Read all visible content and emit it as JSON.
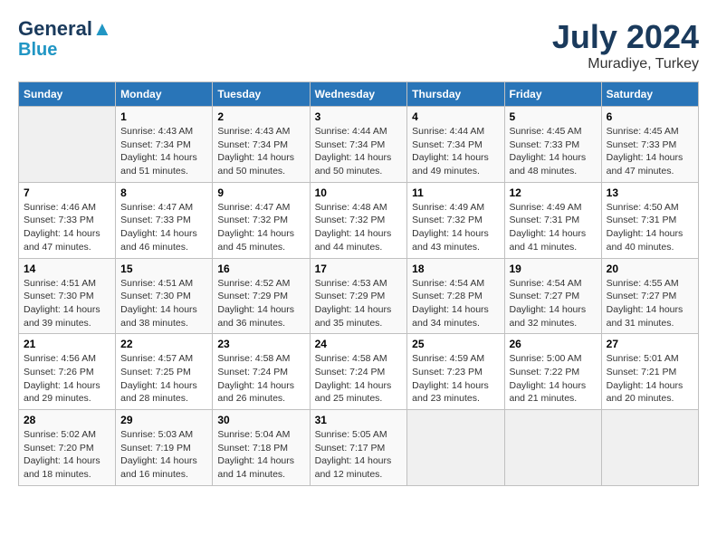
{
  "header": {
    "logo_line1": "General",
    "logo_line2": "Blue",
    "title": "July 2024",
    "subtitle": "Muradiye, Turkey"
  },
  "days_of_week": [
    "Sunday",
    "Monday",
    "Tuesday",
    "Wednesday",
    "Thursday",
    "Friday",
    "Saturday"
  ],
  "weeks": [
    [
      {
        "num": "",
        "sunrise": "",
        "sunset": "",
        "daylight": ""
      },
      {
        "num": "1",
        "sunrise": "Sunrise: 4:43 AM",
        "sunset": "Sunset: 7:34 PM",
        "daylight": "Daylight: 14 hours and 51 minutes."
      },
      {
        "num": "2",
        "sunrise": "Sunrise: 4:43 AM",
        "sunset": "Sunset: 7:34 PM",
        "daylight": "Daylight: 14 hours and 50 minutes."
      },
      {
        "num": "3",
        "sunrise": "Sunrise: 4:44 AM",
        "sunset": "Sunset: 7:34 PM",
        "daylight": "Daylight: 14 hours and 50 minutes."
      },
      {
        "num": "4",
        "sunrise": "Sunrise: 4:44 AM",
        "sunset": "Sunset: 7:34 PM",
        "daylight": "Daylight: 14 hours and 49 minutes."
      },
      {
        "num": "5",
        "sunrise": "Sunrise: 4:45 AM",
        "sunset": "Sunset: 7:33 PM",
        "daylight": "Daylight: 14 hours and 48 minutes."
      },
      {
        "num": "6",
        "sunrise": "Sunrise: 4:45 AM",
        "sunset": "Sunset: 7:33 PM",
        "daylight": "Daylight: 14 hours and 47 minutes."
      }
    ],
    [
      {
        "num": "7",
        "sunrise": "Sunrise: 4:46 AM",
        "sunset": "Sunset: 7:33 PM",
        "daylight": "Daylight: 14 hours and 47 minutes."
      },
      {
        "num": "8",
        "sunrise": "Sunrise: 4:47 AM",
        "sunset": "Sunset: 7:33 PM",
        "daylight": "Daylight: 14 hours and 46 minutes."
      },
      {
        "num": "9",
        "sunrise": "Sunrise: 4:47 AM",
        "sunset": "Sunset: 7:32 PM",
        "daylight": "Daylight: 14 hours and 45 minutes."
      },
      {
        "num": "10",
        "sunrise": "Sunrise: 4:48 AM",
        "sunset": "Sunset: 7:32 PM",
        "daylight": "Daylight: 14 hours and 44 minutes."
      },
      {
        "num": "11",
        "sunrise": "Sunrise: 4:49 AM",
        "sunset": "Sunset: 7:32 PM",
        "daylight": "Daylight: 14 hours and 43 minutes."
      },
      {
        "num": "12",
        "sunrise": "Sunrise: 4:49 AM",
        "sunset": "Sunset: 7:31 PM",
        "daylight": "Daylight: 14 hours and 41 minutes."
      },
      {
        "num": "13",
        "sunrise": "Sunrise: 4:50 AM",
        "sunset": "Sunset: 7:31 PM",
        "daylight": "Daylight: 14 hours and 40 minutes."
      }
    ],
    [
      {
        "num": "14",
        "sunrise": "Sunrise: 4:51 AM",
        "sunset": "Sunset: 7:30 PM",
        "daylight": "Daylight: 14 hours and 39 minutes."
      },
      {
        "num": "15",
        "sunrise": "Sunrise: 4:51 AM",
        "sunset": "Sunset: 7:30 PM",
        "daylight": "Daylight: 14 hours and 38 minutes."
      },
      {
        "num": "16",
        "sunrise": "Sunrise: 4:52 AM",
        "sunset": "Sunset: 7:29 PM",
        "daylight": "Daylight: 14 hours and 36 minutes."
      },
      {
        "num": "17",
        "sunrise": "Sunrise: 4:53 AM",
        "sunset": "Sunset: 7:29 PM",
        "daylight": "Daylight: 14 hours and 35 minutes."
      },
      {
        "num": "18",
        "sunrise": "Sunrise: 4:54 AM",
        "sunset": "Sunset: 7:28 PM",
        "daylight": "Daylight: 14 hours and 34 minutes."
      },
      {
        "num": "19",
        "sunrise": "Sunrise: 4:54 AM",
        "sunset": "Sunset: 7:27 PM",
        "daylight": "Daylight: 14 hours and 32 minutes."
      },
      {
        "num": "20",
        "sunrise": "Sunrise: 4:55 AM",
        "sunset": "Sunset: 7:27 PM",
        "daylight": "Daylight: 14 hours and 31 minutes."
      }
    ],
    [
      {
        "num": "21",
        "sunrise": "Sunrise: 4:56 AM",
        "sunset": "Sunset: 7:26 PM",
        "daylight": "Daylight: 14 hours and 29 minutes."
      },
      {
        "num": "22",
        "sunrise": "Sunrise: 4:57 AM",
        "sunset": "Sunset: 7:25 PM",
        "daylight": "Daylight: 14 hours and 28 minutes."
      },
      {
        "num": "23",
        "sunrise": "Sunrise: 4:58 AM",
        "sunset": "Sunset: 7:24 PM",
        "daylight": "Daylight: 14 hours and 26 minutes."
      },
      {
        "num": "24",
        "sunrise": "Sunrise: 4:58 AM",
        "sunset": "Sunset: 7:24 PM",
        "daylight": "Daylight: 14 hours and 25 minutes."
      },
      {
        "num": "25",
        "sunrise": "Sunrise: 4:59 AM",
        "sunset": "Sunset: 7:23 PM",
        "daylight": "Daylight: 14 hours and 23 minutes."
      },
      {
        "num": "26",
        "sunrise": "Sunrise: 5:00 AM",
        "sunset": "Sunset: 7:22 PM",
        "daylight": "Daylight: 14 hours and 21 minutes."
      },
      {
        "num": "27",
        "sunrise": "Sunrise: 5:01 AM",
        "sunset": "Sunset: 7:21 PM",
        "daylight": "Daylight: 14 hours and 20 minutes."
      }
    ],
    [
      {
        "num": "28",
        "sunrise": "Sunrise: 5:02 AM",
        "sunset": "Sunset: 7:20 PM",
        "daylight": "Daylight: 14 hours and 18 minutes."
      },
      {
        "num": "29",
        "sunrise": "Sunrise: 5:03 AM",
        "sunset": "Sunset: 7:19 PM",
        "daylight": "Daylight: 14 hours and 16 minutes."
      },
      {
        "num": "30",
        "sunrise": "Sunrise: 5:04 AM",
        "sunset": "Sunset: 7:18 PM",
        "daylight": "Daylight: 14 hours and 14 minutes."
      },
      {
        "num": "31",
        "sunrise": "Sunrise: 5:05 AM",
        "sunset": "Sunset: 7:17 PM",
        "daylight": "Daylight: 14 hours and 12 minutes."
      },
      {
        "num": "",
        "sunrise": "",
        "sunset": "",
        "daylight": ""
      },
      {
        "num": "",
        "sunrise": "",
        "sunset": "",
        "daylight": ""
      },
      {
        "num": "",
        "sunrise": "",
        "sunset": "",
        "daylight": ""
      }
    ]
  ]
}
